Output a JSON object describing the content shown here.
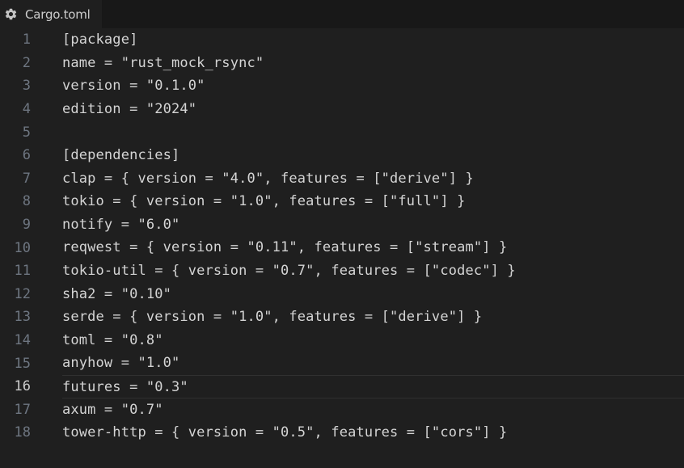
{
  "tab": {
    "title": "Cargo.toml",
    "icon": "gear-icon"
  },
  "editor": {
    "current_line": 16,
    "lines": [
      {
        "number": "1",
        "text": "[package]"
      },
      {
        "number": "2",
        "text": "name = \"rust_mock_rsync\""
      },
      {
        "number": "3",
        "text": "version = \"0.1.0\""
      },
      {
        "number": "4",
        "text": "edition = \"2024\""
      },
      {
        "number": "5",
        "text": ""
      },
      {
        "number": "6",
        "text": "[dependencies]"
      },
      {
        "number": "7",
        "text": "clap = { version = \"4.0\", features = [\"derive\"] }"
      },
      {
        "number": "8",
        "text": "tokio = { version = \"1.0\", features = [\"full\"] }"
      },
      {
        "number": "9",
        "text": "notify = \"6.0\""
      },
      {
        "number": "10",
        "text": "reqwest = { version = \"0.11\", features = [\"stream\"] }"
      },
      {
        "number": "11",
        "text": "tokio-util = { version = \"0.7\", features = [\"codec\"] }"
      },
      {
        "number": "12",
        "text": "sha2 = \"0.10\""
      },
      {
        "number": "13",
        "text": "serde = { version = \"1.0\", features = [\"derive\"] }"
      },
      {
        "number": "14",
        "text": "toml = \"0.8\""
      },
      {
        "number": "15",
        "text": "anyhow = \"1.0\""
      },
      {
        "number": "16",
        "text": "futures = \"0.3\""
      },
      {
        "number": "17",
        "text": "axum = \"0.7\""
      },
      {
        "number": "18",
        "text": "tower-http = { version = \"0.5\", features = [\"cors\"] }"
      }
    ]
  },
  "colors": {
    "background": "#1f1f1f",
    "text": "#d4d4d4",
    "line_number": "#6e7681",
    "line_number_active": "#cccccc",
    "gear": "#c5c5c5"
  }
}
